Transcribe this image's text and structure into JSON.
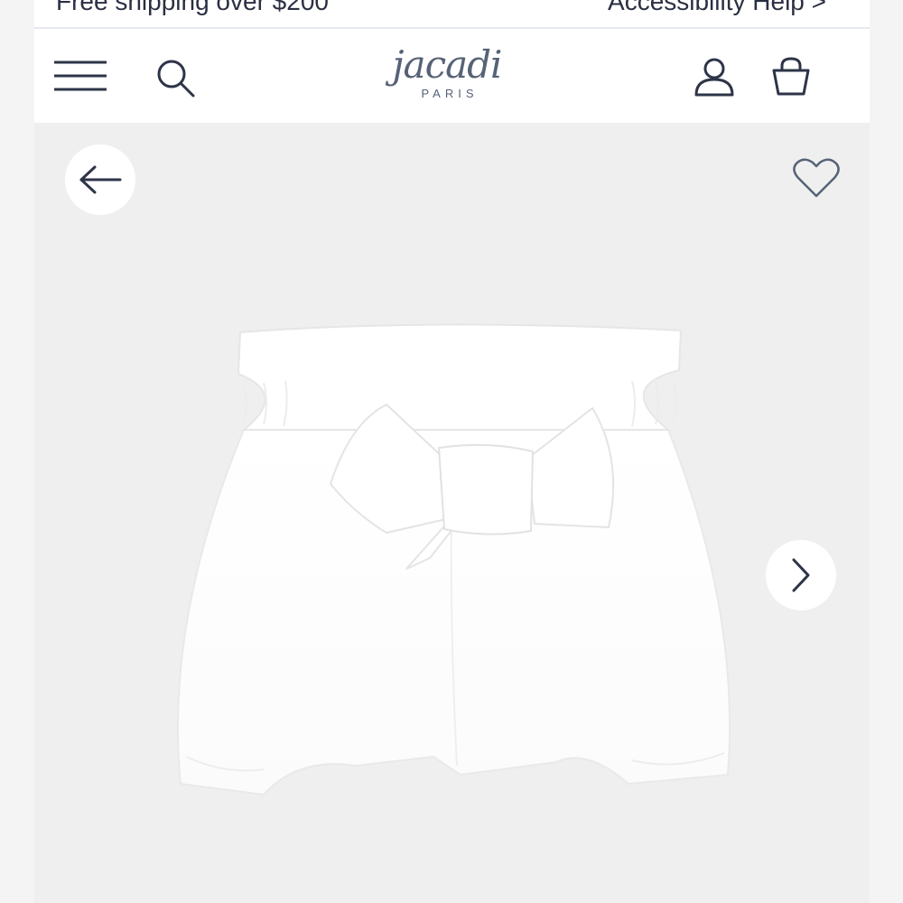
{
  "promo": {
    "left_text": "Free shipping over $200",
    "right_text": "Accessibility Help >"
  },
  "header": {
    "logo_main": "jacadi",
    "logo_sub": "PARIS",
    "icons": [
      "menu-icon",
      "search-icon",
      "account-icon",
      "bag-icon"
    ]
  },
  "gallery": {
    "product_name": "White bloomer shorts with bow",
    "icons": [
      "arrow-left-icon",
      "heart-icon",
      "chevron-right-icon"
    ]
  },
  "colors": {
    "icon": "#2e3448",
    "logo": "#566276",
    "gallery_bg": "#efefef",
    "product": "#ffffff"
  }
}
